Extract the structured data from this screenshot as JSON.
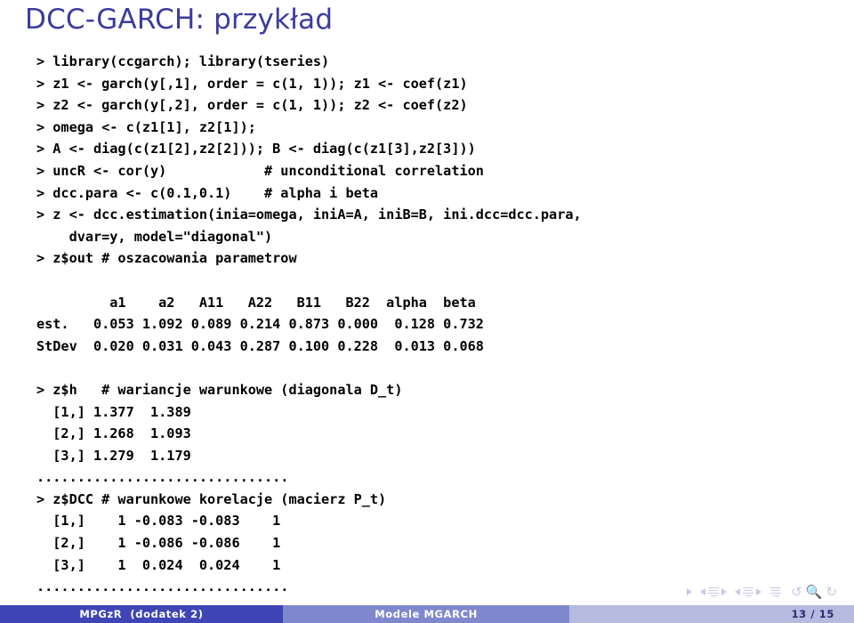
{
  "slide": {
    "title": "DCC-GARCH: przykład",
    "title_color": "#3b3ba0"
  },
  "code": {
    "lines": [
      "> library(ccgarch); library(tseries)",
      "> z1 <- garch(y[,1], order = c(1, 1)); z1 <- coef(z1)",
      "> z2 <- garch(y[,2], order = c(1, 1)); z2 <- coef(z2)",
      "> omega <- c(z1[1], z2[1]);",
      "> A <- diag(c(z1[2],z2[2])); B <- diag(c(z1[3],z2[3]))",
      "> uncR <- cor(y)            # unconditional correlation",
      "> dcc.para <- c(0.1,0.1)    # alpha i beta",
      "> z <- dcc.estimation(inia=omega, iniA=A, iniB=B, ini.dcc=dcc.para,",
      "    dvar=y, model=\"diagonal\")",
      "> z$out # oszacowania parametrow",
      "",
      "         a1    a2   A11   A22   B11   B22  alpha  beta",
      "est.   0.053 1.092 0.089 0.214 0.873 0.000  0.128 0.732",
      "StDev  0.020 0.031 0.043 0.287 0.100 0.228  0.013 0.068",
      "",
      "> z$h   # wariancje warunkowe (diagonala D_t)",
      "  [1,] 1.377  1.389",
      "  [2,] 1.268  1.093",
      "  [3,] 1.279  1.179",
      "...............................",
      "> z$DCC # warunkowe korelacje (macierz P_t)",
      "  [1,]    1 -0.083 -0.083    1",
      "  [2,]    1 -0.086 -0.086    1",
      "  [3,]    1  0.024  0.024    1",
      "..............................."
    ]
  },
  "results_table": {
    "columns": [
      "",
      "a1",
      "a2",
      "A11",
      "A22",
      "B11",
      "B22",
      "alpha",
      "beta"
    ],
    "rows": [
      [
        "est.",
        "0.053",
        "1.092",
        "0.089",
        "0.214",
        "0.873",
        "0.000",
        "0.128",
        "0.732"
      ],
      [
        "StDev",
        "0.020",
        "0.031",
        "0.043",
        "0.287",
        "0.100",
        "0.228",
        "0.013",
        "0.068"
      ]
    ]
  },
  "z_h": {
    "comment": "# wariancje warunkowe (diagonala D_t)",
    "rows": [
      [
        "[1,]",
        "1.377",
        "1.389"
      ],
      [
        "[2,]",
        "1.268",
        "1.093"
      ],
      [
        "[3,]",
        "1.279",
        "1.179"
      ]
    ]
  },
  "z_dcc": {
    "comment": "# warunkowe korelacje (macierz P_t)",
    "rows": [
      [
        "[1,]",
        "1",
        "-0.083",
        "-0.083",
        "1"
      ],
      [
        "[2,]",
        "1",
        "-0.086",
        "-0.086",
        "1"
      ],
      [
        "[3,]",
        "1",
        "0.024",
        "0.024",
        "1"
      ]
    ]
  },
  "nav": {
    "symbols": [
      "slide-forward-icon",
      "frame-back-icon",
      "frame-bars-icon",
      "frame-forward-icon",
      "subsection-back-icon",
      "subsection-bars-icon",
      "subsection-forward-icon",
      "section-bars-icon",
      "back-icon",
      "search-icon",
      "forward-icon"
    ]
  },
  "footer": {
    "author": "MPGzR  (dodatek 2)",
    "subject": "Modele MGARCH",
    "page": "13 / 15",
    "color_a": "#3f45b5",
    "color_b": "#8088cd",
    "color_c": "#b6badf"
  }
}
